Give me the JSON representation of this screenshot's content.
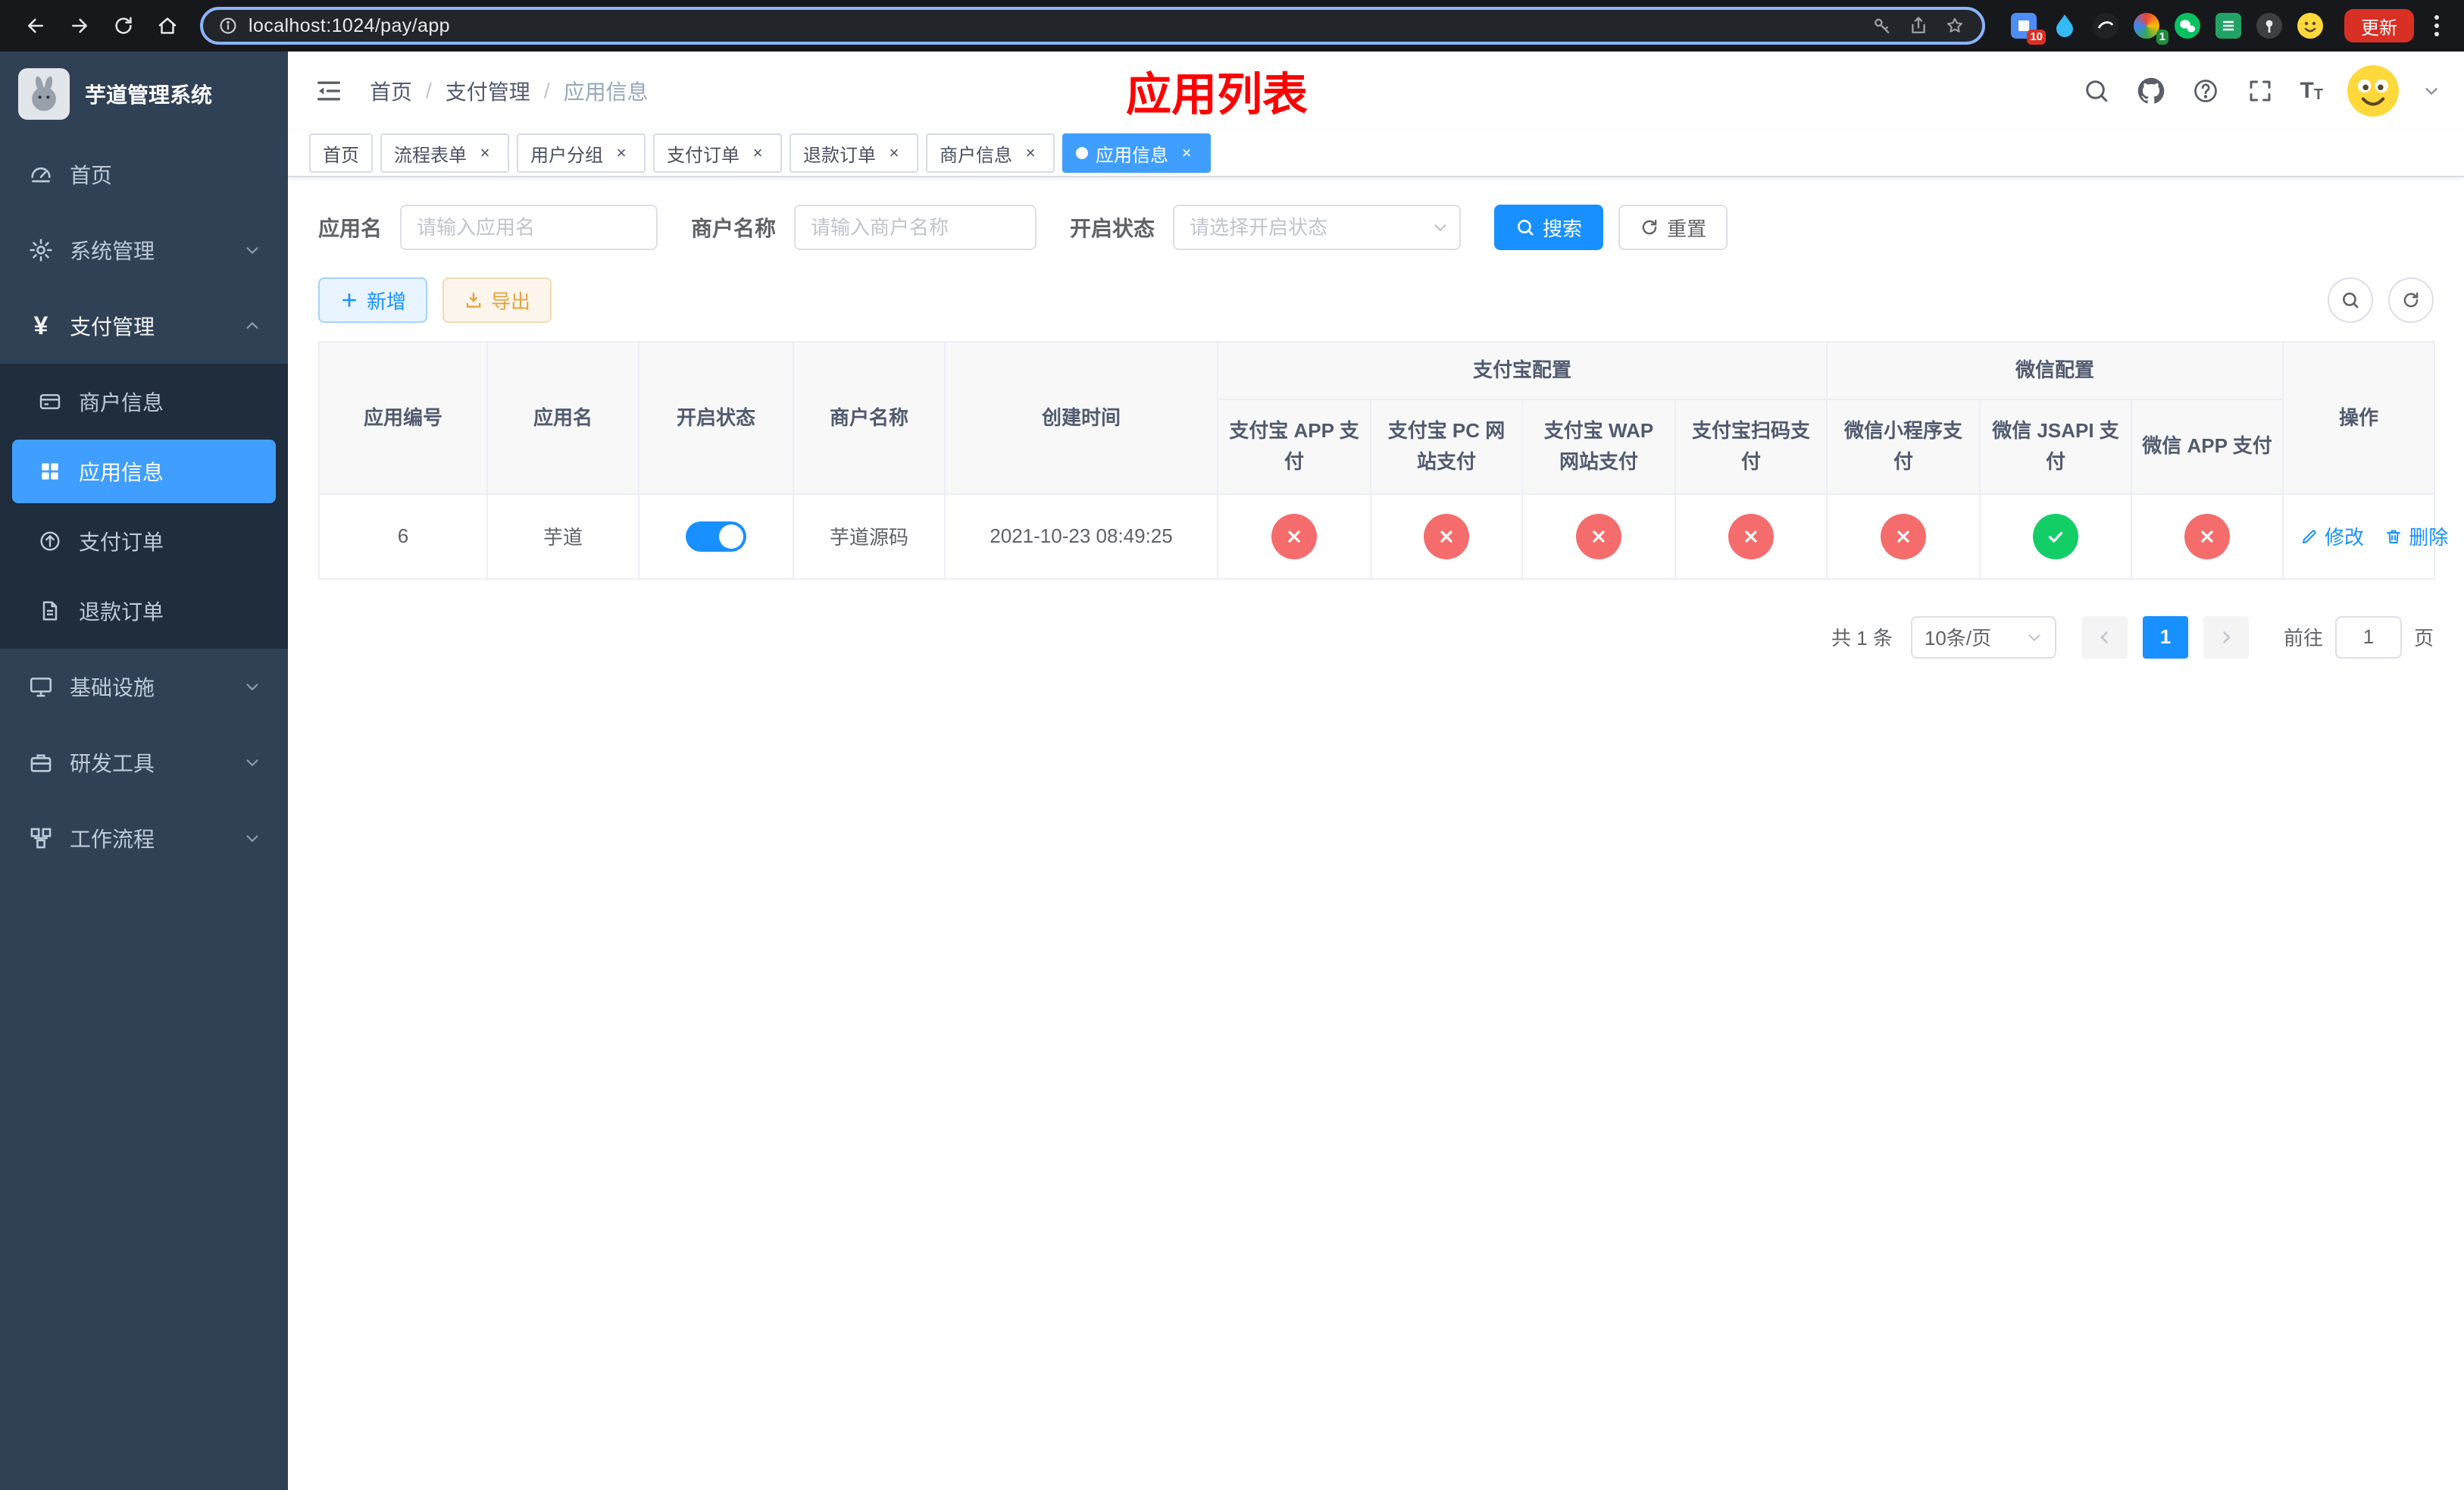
{
  "browser": {
    "url": "localhost:1024/pay/app",
    "update_label": "更新",
    "ext_badge_grid": "10",
    "ext_badge_color": "1"
  },
  "sidebar": {
    "title": "芋道管理系统",
    "items": [
      {
        "label": "首页"
      },
      {
        "label": "系统管理"
      },
      {
        "label": "支付管理",
        "children": [
          {
            "label": "商户信息"
          },
          {
            "label": "应用信息"
          },
          {
            "label": "支付订单"
          },
          {
            "label": "退款订单"
          }
        ]
      },
      {
        "label": "基础设施"
      },
      {
        "label": "研发工具"
      },
      {
        "label": "工作流程"
      }
    ]
  },
  "header": {
    "breadcrumb": [
      "首页",
      "支付管理",
      "应用信息"
    ],
    "page_title": "应用列表"
  },
  "tabs": [
    {
      "label": "首页"
    },
    {
      "label": "流程表单"
    },
    {
      "label": "用户分组"
    },
    {
      "label": "支付订单"
    },
    {
      "label": "退款订单"
    },
    {
      "label": "商户信息"
    },
    {
      "label": "应用信息"
    }
  ],
  "filters": {
    "app_name_label": "应用名",
    "app_name_placeholder": "请输入应用名",
    "merchant_label": "商户名称",
    "merchant_placeholder": "请输入商户名称",
    "status_label": "开启状态",
    "status_placeholder": "请选择开启状态",
    "search_label": "搜索",
    "reset_label": "重置"
  },
  "toolbar": {
    "add_label": "新增",
    "export_label": "导出"
  },
  "table": {
    "groups": {
      "alipay": "支付宝配置",
      "wechat": "微信配置"
    },
    "columns": [
      "应用编号",
      "应用名",
      "开启状态",
      "商户名称",
      "创建时间",
      "支付宝 APP 支付",
      "支付宝 PC 网站支付",
      "支付宝 WAP 网站支付",
      "支付宝扫码支付",
      "微信小程序支付",
      "微信 JSAPI 支付",
      "微信 APP 支付",
      "操作"
    ],
    "rows": [
      {
        "id": "6",
        "name": "芋道",
        "enabled": true,
        "merchant": "芋道源码",
        "created": "2021-10-23 08:49:25",
        "configs": [
          "no",
          "no",
          "no",
          "no",
          "no",
          "yes",
          "no"
        ],
        "edit_label": "修改",
        "delete_label": "删除"
      }
    ]
  },
  "pagination": {
    "total": "共 1 条",
    "page_size": "10条/页",
    "page": "1",
    "goto_label": "前往",
    "goto_value": "1",
    "unit": "页"
  }
}
